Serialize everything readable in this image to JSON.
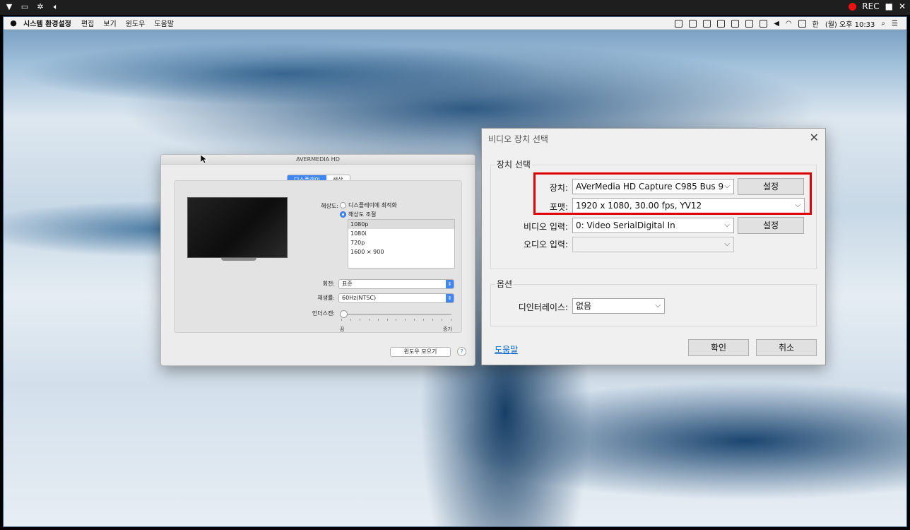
{
  "capture_bar": {
    "rec_label": "REC"
  },
  "menubar": {
    "app_name": "시스템 환경설정",
    "menus": [
      "편집",
      "보기",
      "윈도우",
      "도움말"
    ],
    "status_badge": "한",
    "datetime": "(월) 오후 10:33"
  },
  "mac_window": {
    "title": "AVERMEDIA HD",
    "tabs": [
      "디스플레이",
      "색상"
    ],
    "resolution_label": "해상도:",
    "resolution_options": [
      "디스플레이에 최적화",
      "해상도 조절"
    ],
    "resolution_selected": "해상도 조절",
    "resolution_list": [
      "1080p",
      "1080i",
      "720p",
      "1600 × 900"
    ],
    "rotation_label": "회전:",
    "rotation_value": "표준",
    "refresh_label": "재생률:",
    "refresh_value": "60Hz(NTSC)",
    "underscan_label": "언더스캔:",
    "underscan_min": "끔",
    "underscan_max": "증가",
    "gather_windows_button": "윈도우 모으기",
    "help_button": "?"
  },
  "win_dialog": {
    "title": "비디오 장치 선택",
    "close_glyph": "✕",
    "group_device": "장치 선택",
    "device_label": "장치:",
    "device_value": "AVerMedia HD Capture C985 Bus 9",
    "format_label": "포맷:",
    "format_value": "1920 x 1080, 30.00 fps, YV12",
    "video_input_label": "비디오 입력:",
    "video_input_value": "0: Video SerialDigital In",
    "audio_input_label": "오디오 입력:",
    "audio_input_value": "",
    "settings_button": "설정",
    "group_options": "옵션",
    "deinterlace_label": "디인터레이스:",
    "deinterlace_value": "없음",
    "help_link": "도움말",
    "ok_button": "확인",
    "cancel_button": "취소"
  },
  "colors": {
    "highlight_red": "#e00000",
    "mac_accent": "#3f86f3",
    "link_blue": "#0066cc"
  }
}
